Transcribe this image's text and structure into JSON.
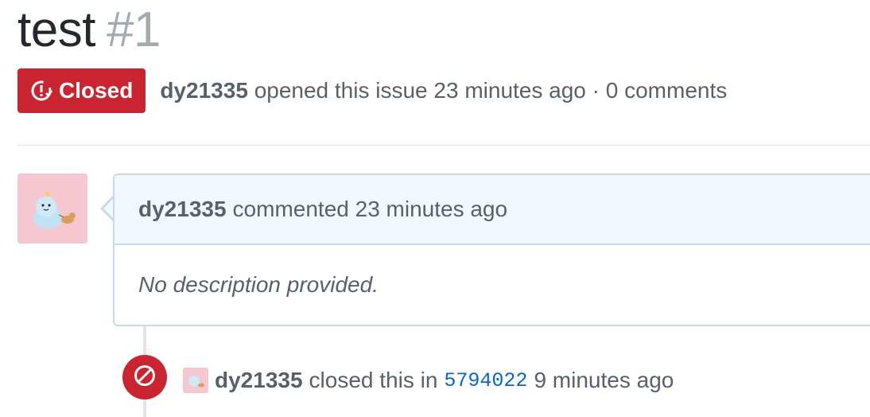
{
  "issue": {
    "title": "test",
    "number": "#1",
    "state_label": "Closed",
    "author": "dy21335",
    "opened_text": "opened this issue 23 minutes ago · 0 comments"
  },
  "comment": {
    "author": "dy21335",
    "header_text": "commented 23 minutes ago",
    "body": "No description provided."
  },
  "event": {
    "author": "dy21335",
    "action_text": "closed this in",
    "commit": "5794022",
    "time_text": "9 minutes ago"
  },
  "colors": {
    "closed_red": "#cb2431",
    "link_blue": "#0366d6",
    "comment_header_bg": "#f1f8ff",
    "comment_border": "#c6d9ee",
    "avatar_pink": "#f5c7d0"
  },
  "icons": {
    "state_badge": "issue-closed-icon",
    "event_badge": "circle-slash-icon"
  }
}
